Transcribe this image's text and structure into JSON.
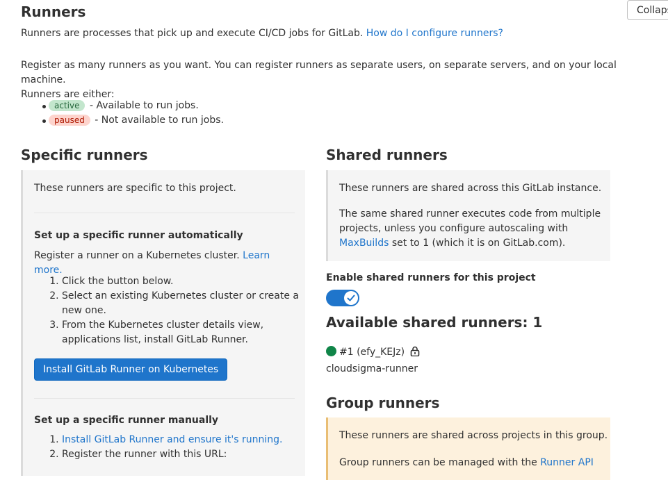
{
  "header": {
    "title": "Runners",
    "collapse_label": "Collaps",
    "intro_text": "Runners are processes that pick up and execute CI/CD jobs for GitLab.",
    "intro_link": "How do I configure runners?",
    "register_text_1": "Register as many runners as you want. You can register runners as separate users, on separate servers, and on your local machine.",
    "register_text_2": "Runners are either:",
    "status_items": [
      {
        "badge": "active",
        "desc": "- Available to run jobs."
      },
      {
        "badge": "paused",
        "desc": "- Not available to run jobs."
      }
    ]
  },
  "specific": {
    "title": "Specific runners",
    "description": "These runners are specific to this project.",
    "auto_heading": "Set up a specific runner automatically",
    "auto_text": "Register a runner on a Kubernetes cluster.",
    "auto_link": "Learn more.",
    "auto_steps": [
      "Click the button below.",
      "Select an existing Kubernetes cluster or create a new one.",
      "From the Kubernetes cluster details view, applications list, install GitLab Runner."
    ],
    "install_button": "Install GitLab Runner on Kubernetes",
    "manual_heading": "Set up a specific runner manually",
    "manual_step_1_link": "Install GitLab Runner and ensure it's running.",
    "manual_step_2": "Register the runner with this URL:"
  },
  "shared": {
    "title": "Shared runners",
    "description": "These runners are shared across this GitLab instance.",
    "info_1": "The same shared runner executes code from multiple projects, unless you configure autoscaling with",
    "info_link": "MaxBuilds",
    "info_2": "set to 1 (which it is on GitLab.com).",
    "toggle_label": "Enable shared runners for this project",
    "toggle_on": true,
    "available_title": "Available shared runners: 1",
    "runner_id": "#1 (efy_KEJz)",
    "runner_name": "cloudsigma-runner",
    "status_color": "#108548"
  },
  "group": {
    "title": "Group runners",
    "description": "These runners are shared across projects in this group.",
    "info_text": "Group runners can be managed with the",
    "info_link": "Runner API"
  },
  "colors": {
    "link": "#1f75cb",
    "primary": "#1f75cb",
    "panel": "#f5f5f5",
    "warning_panel": "#fdf1dd"
  }
}
